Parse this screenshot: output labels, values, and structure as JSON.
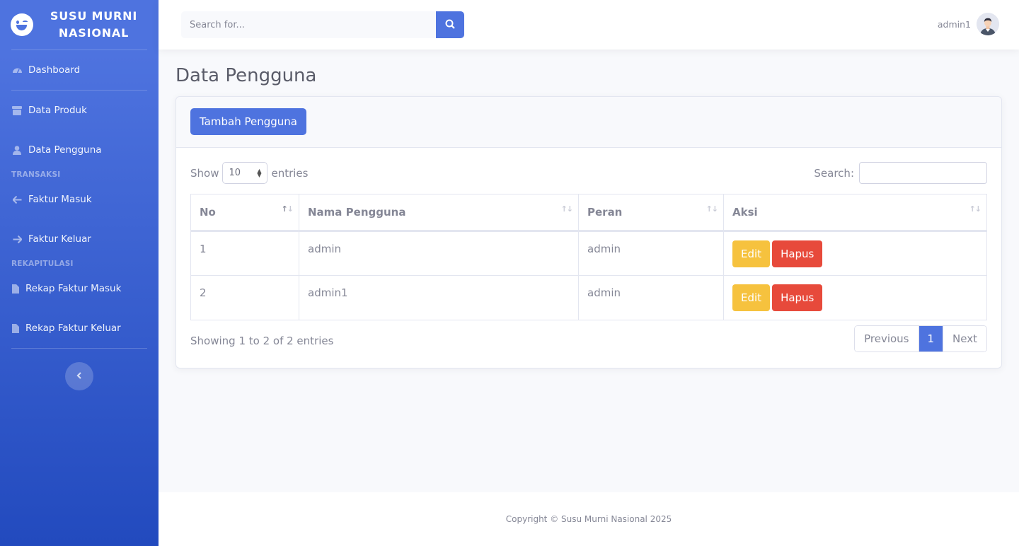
{
  "brand": {
    "line1": "SUSU MURNI",
    "line2": "NASIONAL"
  },
  "sidebar": {
    "items": [
      {
        "label": "Dashboard",
        "icon": "tachometer-icon"
      },
      {
        "label": "Data Produk",
        "icon": "box-icon"
      },
      {
        "label": "Data Pengguna",
        "icon": "user-icon"
      }
    ],
    "heading_transaksi": "TRANSAKSI",
    "transaksi": [
      {
        "label": "Faktur Masuk",
        "icon": "arrow-left-icon"
      },
      {
        "label": "Faktur Keluar",
        "icon": "arrow-right-icon"
      }
    ],
    "heading_rekap": "REKAPITULASI",
    "rekap": [
      {
        "label": "Rekap Faktur Masuk",
        "icon": "file-icon"
      },
      {
        "label": "Rekap Faktur Keluar",
        "icon": "file-icon"
      }
    ],
    "toggle_icon": "chevron-left-icon"
  },
  "topbar": {
    "search_placeholder": "Search for...",
    "username": "admin1"
  },
  "page": {
    "title": "Data Pengguna"
  },
  "card": {
    "add_button": "Tambah Pengguna",
    "length": {
      "show": "Show",
      "value": "10",
      "entries": "entries"
    },
    "filter_label": "Search:",
    "columns": [
      "No",
      "Nama Pengguna",
      "Peran",
      "Aksi"
    ],
    "rows": [
      {
        "no": "1",
        "nama": "admin",
        "peran": "admin",
        "edit": "Edit",
        "hapus": "Hapus"
      },
      {
        "no": "2",
        "nama": "admin1",
        "peran": "admin",
        "edit": "Edit",
        "hapus": "Hapus"
      }
    ],
    "info": "Showing 1 to 2 of 2 entries",
    "pagination": {
      "previous": "Previous",
      "current": "1",
      "next": "Next"
    }
  },
  "footer": {
    "text": "Copyright © Susu Murni Nasional 2025"
  },
  "colors": {
    "primary": "#4e73df",
    "warning": "#f6c23e",
    "danger": "#e74a3b"
  }
}
